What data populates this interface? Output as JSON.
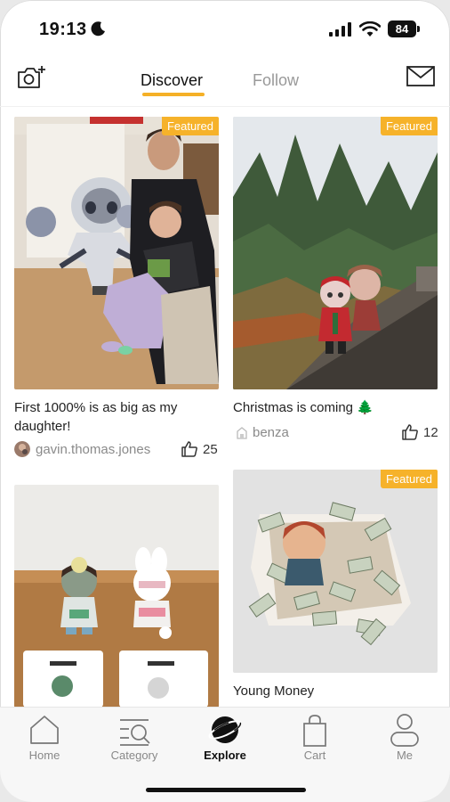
{
  "status_bar": {
    "time": "19:13",
    "battery": "84"
  },
  "header": {
    "tabs": [
      {
        "label": "Discover",
        "active": true
      },
      {
        "label": "Follow",
        "active": false
      }
    ]
  },
  "feed": [
    {
      "badge": "Featured",
      "caption": "First 1000% is as big as my daughter!",
      "user": "gavin.thomas.jones",
      "likes": "25"
    },
    {
      "badge": "Featured",
      "caption": "Christmas is coming 🌲",
      "user": "benza",
      "likes": "12"
    },
    {
      "badge": "",
      "caption": "",
      "user": "",
      "likes": ""
    },
    {
      "badge": "Featured",
      "caption": "Young Money",
      "user": "",
      "likes": ""
    }
  ],
  "bottom_nav": [
    {
      "label": "Home",
      "icon": "home-icon",
      "active": false
    },
    {
      "label": "Category",
      "icon": "category-search-icon",
      "active": false
    },
    {
      "label": "Explore",
      "icon": "planet-icon",
      "active": true
    },
    {
      "label": "Cart",
      "icon": "shopping-bag-icon",
      "active": false
    },
    {
      "label": "Me",
      "icon": "person-icon",
      "active": false
    }
  ],
  "colors": {
    "accent": "#f5b027",
    "badge": "#f6b22a",
    "muted_text": "#999999"
  }
}
